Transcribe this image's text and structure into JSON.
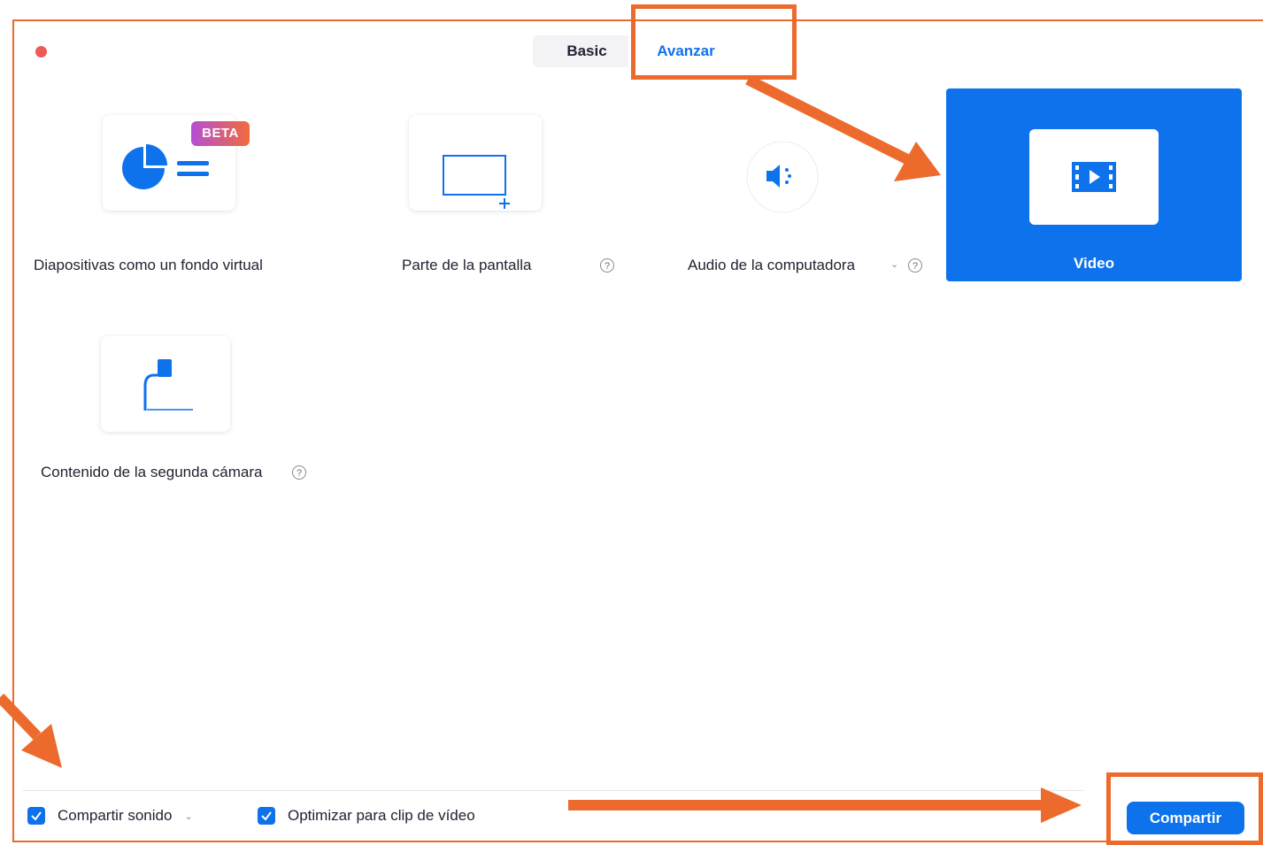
{
  "tabs": [
    {
      "label": "Basic"
    },
    {
      "label": "Avanzar"
    }
  ],
  "options": [
    {
      "label": "Diapositivas como un fondo virtual",
      "badge": "BETA",
      "icon": "slides-icon"
    },
    {
      "label": "Parte de la pantalla",
      "help": "?",
      "icon": "screen-portion-icon"
    },
    {
      "label": "Audio de la computadora",
      "help": "?",
      "icon": "speaker-icon"
    },
    {
      "label": "Video",
      "icon": "video-icon",
      "selected": true
    },
    {
      "label": "Contenido de la segunda cámara",
      "help": "?",
      "icon": "camera-icon"
    }
  ],
  "footer": {
    "share_sound": {
      "label": "Compartir sonido",
      "checked": true
    },
    "optimize_video": {
      "label": "Optimizar para clip de vídeo",
      "checked": true
    },
    "share_button": "Compartir"
  },
  "colors": {
    "accent": "#0e72ed",
    "highlight": "#ec6a2c",
    "close": "#ee5a58"
  }
}
